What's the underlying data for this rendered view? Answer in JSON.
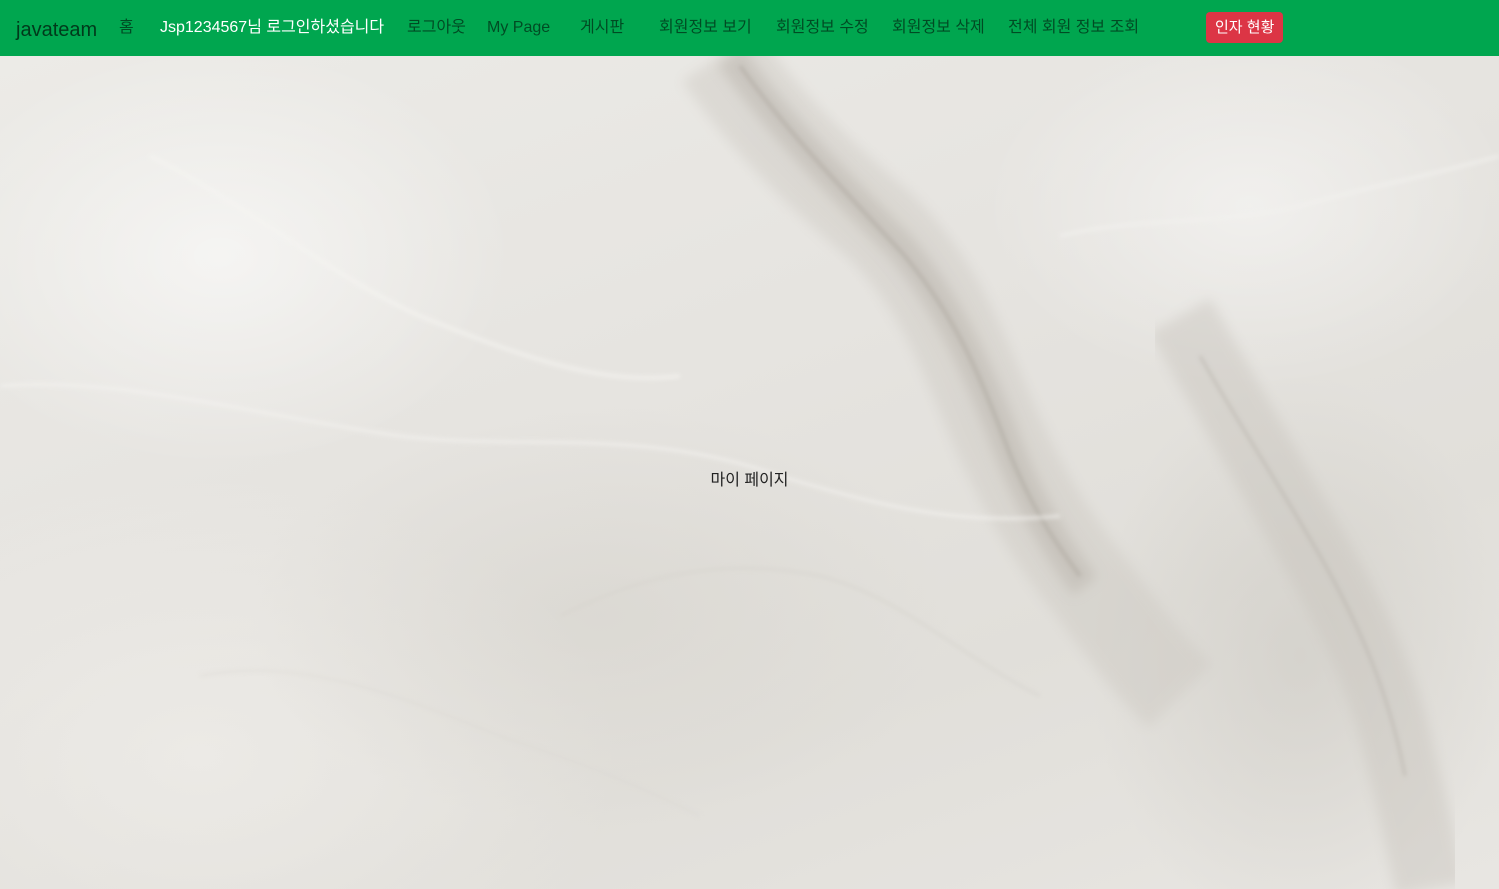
{
  "navbar": {
    "brand": "javateam",
    "links": {
      "home": "홈",
      "user_greeting": "Jsp1234567님 로그인하셨습니다",
      "logout": "로그아웃",
      "mypage": "My Page",
      "board": "게시판",
      "member_view": "회원정보 보기",
      "member_update": "회원정보 수정",
      "member_delete": "회원정보 삭제",
      "member_all": "전체 회원 정보 조회"
    },
    "stats_button": "인자 현황"
  },
  "main": {
    "title": "마이 페이지"
  },
  "colors": {
    "navbar_bg": "#00a64f",
    "button_bg": "#dc3545",
    "background": "#e9e7e3"
  }
}
